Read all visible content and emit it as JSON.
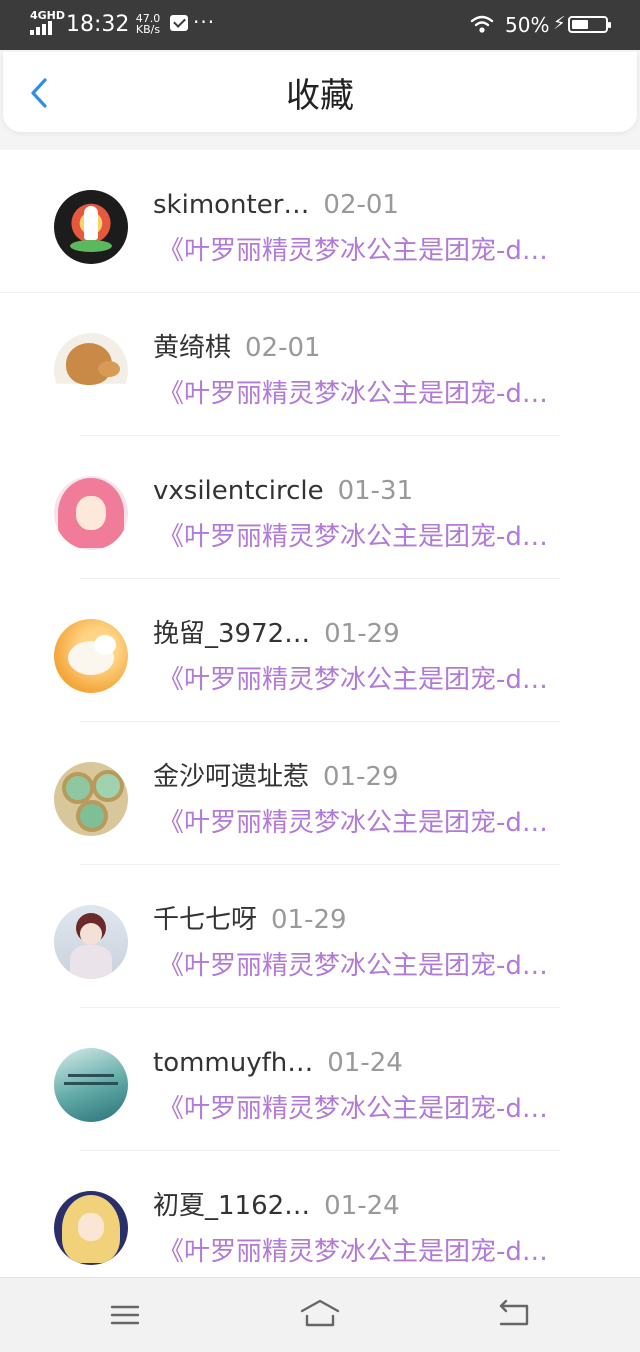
{
  "status_bar": {
    "network": "4GHD",
    "time": "18:32",
    "speed_value": "47.0",
    "speed_unit": "KB/s",
    "dots": "···",
    "battery_percent": "50%",
    "battery_level": 0.5,
    "bolt": "⚡"
  },
  "header": {
    "title": "收藏",
    "back_icon": "chevron-left-icon",
    "accent_color": "#2f8fe6"
  },
  "list": {
    "text_color": "#b07ad6",
    "items": [
      {
        "name": "skimonter…",
        "date": "02-01",
        "subtitle": "《叶罗丽精灵梦冰公主是团宠-d…",
        "avatar": "guanyin-avatar"
      },
      {
        "name": "黄绮棋",
        "date": "02-01",
        "subtitle": "《叶罗丽精灵梦冰公主是团宠-d…",
        "avatar": "dog-avatar"
      },
      {
        "name": "vxsilentcircle",
        "date": "01-31",
        "subtitle": "《叶罗丽精灵梦冰公主是团宠-d…",
        "avatar": "anime-girl-pink-avatar"
      },
      {
        "name": "挽留_3972…",
        "date": "01-29",
        "subtitle": "《叶罗丽精灵梦冰公主是团宠-d…",
        "avatar": "kitten-avatar"
      },
      {
        "name": "金沙呵遗址惹",
        "date": "01-29",
        "subtitle": "《叶罗丽精灵梦冰公主是团宠-d…",
        "avatar": "cookies-avatar"
      },
      {
        "name": "千七七呀",
        "date": "01-29",
        "subtitle": "《叶罗丽精灵梦冰公主是团宠-d…",
        "avatar": "girl-photo-avatar"
      },
      {
        "name": "tommuyfh…",
        "date": "01-24",
        "subtitle": "《叶罗丽精灵梦冰公主是团宠-d…",
        "avatar": "teal-text-avatar"
      },
      {
        "name": "初夏_1162…",
        "date": "01-24",
        "subtitle": "《叶罗丽精灵梦冰公主是团宠-d…",
        "avatar": "anime-girl-blonde-avatar"
      }
    ]
  },
  "nav_bar": {
    "icons": [
      "menu-icon",
      "home-icon",
      "back-arrow-icon"
    ]
  }
}
